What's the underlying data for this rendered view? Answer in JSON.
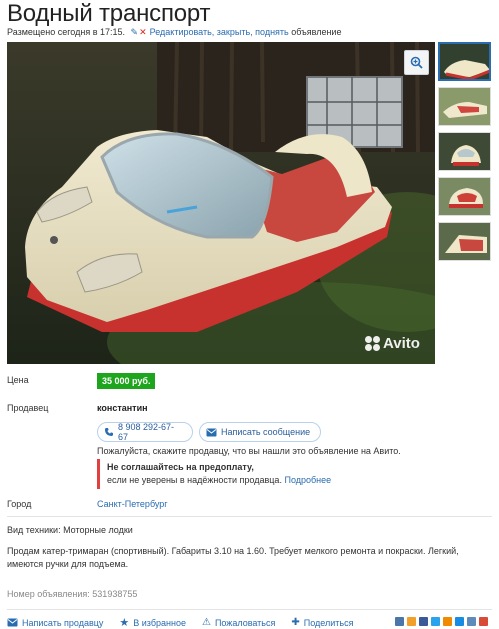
{
  "header": {
    "title": "Водный транспорт",
    "posted": "Размещено сегодня в 17:15.",
    "edit_link": "Редактировать, закрыть, поднять",
    "edit_suffix": "объявление"
  },
  "gallery": {
    "zoom_icon": "zoom-icon",
    "watermark": "Avito",
    "thumbnail_count": 5,
    "active_thumbnail": 1
  },
  "price": {
    "label": "Цена",
    "value": "35 000 руб."
  },
  "seller": {
    "label": "Продавец",
    "name": "константин",
    "phone": "8 908 292-67-67",
    "message_button": "Написать сообщение",
    "hint": "Пожалуйста, скажите продавцу, что вы нашли это объявление на Авито.",
    "warning_title": "Не соглашайтесь на предоплату,",
    "warning_text": "если не уверены в надёжности продавца.",
    "warning_link": "Подробнее"
  },
  "city": {
    "label": "Город",
    "value": "Санкт-Петербург"
  },
  "details": {
    "type": "Вид техники: Моторные лодки",
    "description": "Продам катер-тримаран (спортивный). Габариты 3.10 на 1.60. Требует мелкого ремонта и покраски. Легкий, имеются ручки для подъема."
  },
  "ad_number": {
    "label": "Номер объявления:",
    "value": "531938755"
  },
  "actions": {
    "write_seller": "Написать продавцу",
    "favorite": "В избранное",
    "complain": "Пожаловаться",
    "share": "Поделиться"
  },
  "colors": {
    "link": "#2a6cb0",
    "price_badge": "#1ea51e",
    "warning_border": "#e04040"
  }
}
